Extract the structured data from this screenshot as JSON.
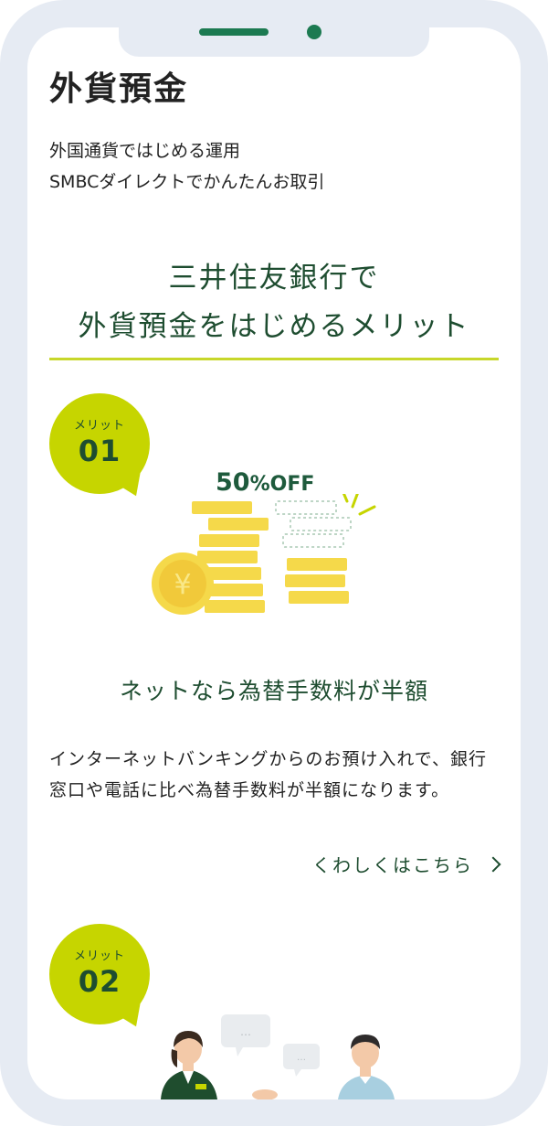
{
  "page": {
    "title": "外貨預金",
    "subtitle_lines": [
      "外国通貨ではじめる運用",
      "SMBCダイレクトでかんたんお取引"
    ]
  },
  "merits_heading": {
    "line1": "三井住友銀行で",
    "line2": "外貨預金をはじめるメリット"
  },
  "merit1": {
    "badge_label": "メリット",
    "badge_number": "01",
    "illustration_badge": {
      "number": "50",
      "unit": "%OFF"
    },
    "coin_symbol": "¥",
    "title": "ネットなら為替手数料が半額",
    "body": "インターネットバンキングからのお預け入れで、銀行窓口や電話に比べ為替手数料が半額になります。",
    "link_label": "くわしくはこちら"
  },
  "merit2": {
    "badge_label": "メリット",
    "badge_number": "02",
    "speech_bubble_text": "…"
  },
  "colors": {
    "accent_green": "#1e4d30",
    "badge_lime": "#c6d500",
    "rule_lime": "#c7d72a",
    "coin_yellow": "#f5d94a",
    "frame": "#e6ebf3"
  }
}
